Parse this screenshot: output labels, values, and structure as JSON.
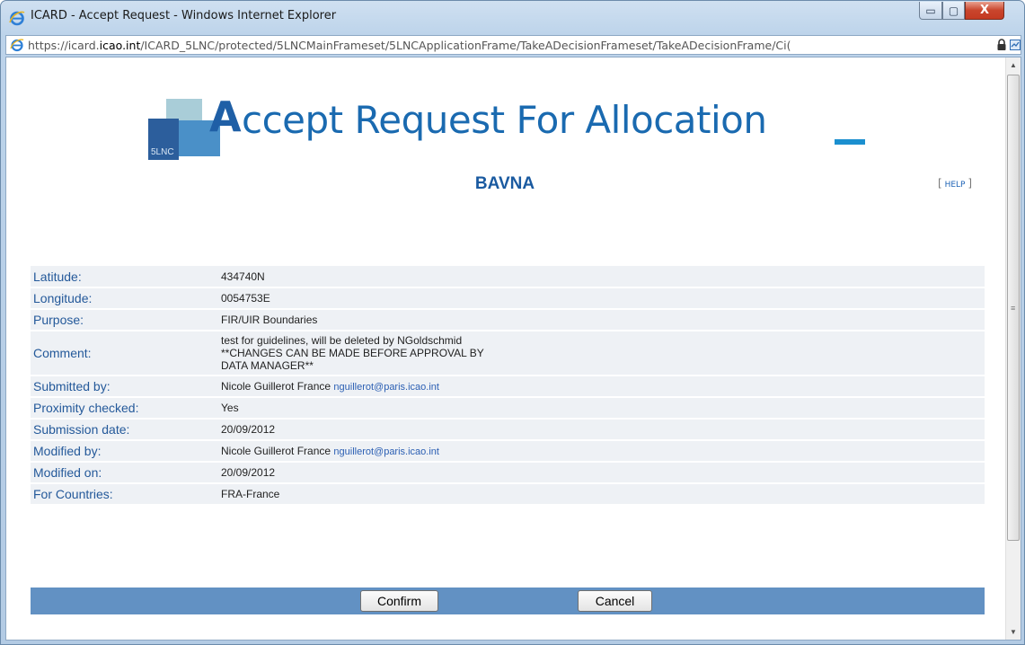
{
  "window": {
    "title": "ICARD - Accept Request - Windows Internet Explorer",
    "controls": {
      "minimize": "▭",
      "maximize": "▢",
      "close": "X"
    }
  },
  "address": {
    "url_prefix": "https://icard.",
    "url_domain": "icao.int",
    "url_rest": "/ICARD_5LNC/protected/5LNCMainFrameset/5LNCApplicationFrame/TakeADecisionFrameset/TakeADecisionFrame/Ci("
  },
  "page": {
    "logo_text": "5LNC",
    "title_initial": "A",
    "title_rest": "ccept Request For Allocation",
    "subtitle": "BAVNA",
    "help": {
      "open": "[",
      "label": "HELP",
      "close": "]"
    }
  },
  "details": {
    "latitude": {
      "label": "Latitude:",
      "value": "434740N"
    },
    "longitude": {
      "label": "Longitude:",
      "value": "0054753E"
    },
    "purpose": {
      "label": "Purpose:",
      "value": "FIR/UIR Boundaries"
    },
    "comment": {
      "label": "Comment:",
      "line1": "test for guidelines, will be deleted by NGoldschmid",
      "line2": "**CHANGES CAN BE MADE BEFORE APPROVAL BY",
      "line3": "DATA MANAGER**"
    },
    "submitted_by": {
      "label": "Submitted by:",
      "name": "Nicole Guillerot France",
      "email": "nguillerot@paris.icao.int"
    },
    "proximity": {
      "label": "Proximity checked:",
      "value": "Yes"
    },
    "submission_date": {
      "label": "Submission date:",
      "value": "20/09/2012"
    },
    "modified_by": {
      "label": "Modified by:",
      "name": "Nicole Guillerot France",
      "email": "nguillerot@paris.icao.int"
    },
    "modified_on": {
      "label": "Modified on:",
      "value": "20/09/2012"
    },
    "countries": {
      "label": "For Countries:",
      "value": "FRA-France"
    }
  },
  "actions": {
    "confirm": "Confirm",
    "cancel": "Cancel"
  },
  "colors": {
    "accent": "#1a6ab0",
    "action_bar": "#6291c3",
    "row_bg": "#eef1f5"
  }
}
